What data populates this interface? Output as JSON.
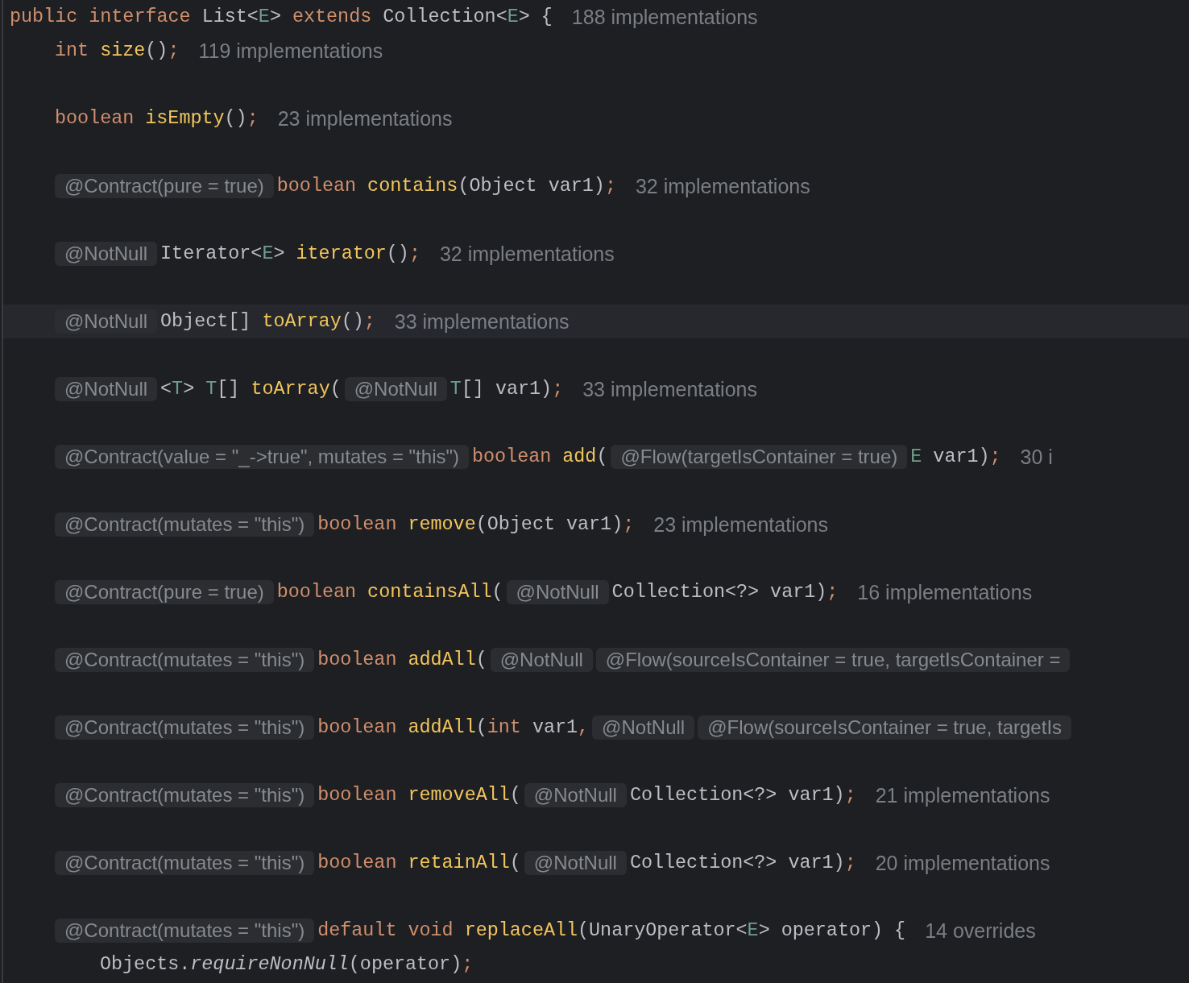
{
  "code": [
    {
      "kind": "code",
      "current": false,
      "tokens": [
        {
          "kind": "kw",
          "text": "public interface "
        },
        {
          "kind": "type",
          "text": "List"
        },
        {
          "kind": "punct",
          "text": "<"
        },
        {
          "kind": "tp",
          "text": "E"
        },
        {
          "kind": "punct",
          "text": "> "
        },
        {
          "kind": "kw",
          "text": "extends "
        },
        {
          "kind": "type",
          "text": "Collection"
        },
        {
          "kind": "punct",
          "text": "<"
        },
        {
          "kind": "tp",
          "text": "E"
        },
        {
          "kind": "punct",
          "text": "> {"
        }
      ],
      "hint": "188 implementations",
      "children": [
        {
          "kind": "code",
          "current": false,
          "tokens": [
            {
              "kind": "kw",
              "text": "int "
            },
            {
              "kind": "fn",
              "text": "size"
            },
            {
              "kind": "punct",
              "text": "()"
            },
            {
              "kind": "semi",
              "text": ";"
            }
          ],
          "hint": "119 implementations"
        },
        {
          "kind": "blank"
        },
        {
          "kind": "code",
          "current": false,
          "tokens": [
            {
              "kind": "kw",
              "text": "boolean "
            },
            {
              "kind": "fn",
              "text": "isEmpty"
            },
            {
              "kind": "punct",
              "text": "()"
            },
            {
              "kind": "semi",
              "text": ";"
            }
          ],
          "hint": "23 implementations"
        },
        {
          "kind": "blank"
        },
        {
          "kind": "code",
          "current": false,
          "tokens": [
            {
              "kind": "inlay",
              "text": "@Contract(pure = true)"
            },
            {
              "kind": "kw",
              "text": "boolean "
            },
            {
              "kind": "fn",
              "text": "contains"
            },
            {
              "kind": "punct",
              "text": "(Object var1)"
            },
            {
              "kind": "semi",
              "text": ";"
            }
          ],
          "hint": "32 implementations"
        },
        {
          "kind": "blank"
        },
        {
          "kind": "code",
          "current": false,
          "tokens": [
            {
              "kind": "inlay",
              "text": "@NotNull"
            },
            {
              "kind": "type",
              "text": "Iterator"
            },
            {
              "kind": "punct",
              "text": "<"
            },
            {
              "kind": "tp",
              "text": "E"
            },
            {
              "kind": "punct",
              "text": "> "
            },
            {
              "kind": "fn",
              "text": "iterator"
            },
            {
              "kind": "punct",
              "text": "()"
            },
            {
              "kind": "semi",
              "text": ";"
            }
          ],
          "hint": "32 implementations"
        },
        {
          "kind": "blank"
        },
        {
          "kind": "code",
          "current": true,
          "tokens": [
            {
              "kind": "inlay",
              "text": "@NotNull"
            },
            {
              "kind": "type",
              "text": "Object[] "
            },
            {
              "kind": "fn",
              "text": "toArray"
            },
            {
              "kind": "punct",
              "text": "()"
            },
            {
              "kind": "semi",
              "text": ";"
            }
          ],
          "hint": "33 implementations"
        },
        {
          "kind": "blank"
        },
        {
          "kind": "code",
          "current": false,
          "tokens": [
            {
              "kind": "inlay",
              "text": "@NotNull"
            },
            {
              "kind": "punct",
              "text": "<"
            },
            {
              "kind": "tp",
              "text": "T"
            },
            {
              "kind": "punct",
              "text": "> "
            },
            {
              "kind": "tp",
              "text": "T"
            },
            {
              "kind": "punct",
              "text": "[] "
            },
            {
              "kind": "fn",
              "text": "toArray"
            },
            {
              "kind": "punct",
              "text": "("
            },
            {
              "kind": "inlay",
              "text": "@NotNull"
            },
            {
              "kind": "tp",
              "text": "T"
            },
            {
              "kind": "punct",
              "text": "[] var1)"
            },
            {
              "kind": "semi",
              "text": ";"
            }
          ],
          "hint": "33 implementations"
        },
        {
          "kind": "blank"
        },
        {
          "kind": "code",
          "current": false,
          "tokens": [
            {
              "kind": "inlay",
              "text": "@Contract(value = \"_->true\", mutates = \"this\")"
            },
            {
              "kind": "kw",
              "text": "boolean "
            },
            {
              "kind": "fn",
              "text": "add"
            },
            {
              "kind": "punct",
              "text": "("
            },
            {
              "kind": "inlay",
              "text": "@Flow(targetIsContainer = true)"
            },
            {
              "kind": "tp",
              "text": "E"
            },
            {
              "kind": "punct",
              "text": " var1)"
            },
            {
              "kind": "semi",
              "text": ";"
            }
          ],
          "hint": "30 i"
        },
        {
          "kind": "blank"
        },
        {
          "kind": "code",
          "current": false,
          "tokens": [
            {
              "kind": "inlay",
              "text": "@Contract(mutates = \"this\")"
            },
            {
              "kind": "kw",
              "text": "boolean "
            },
            {
              "kind": "fn",
              "text": "remove"
            },
            {
              "kind": "punct",
              "text": "(Object var1)"
            },
            {
              "kind": "semi",
              "text": ";"
            }
          ],
          "hint": "23 implementations"
        },
        {
          "kind": "blank"
        },
        {
          "kind": "code",
          "current": false,
          "tokens": [
            {
              "kind": "inlay",
              "text": "@Contract(pure = true)"
            },
            {
              "kind": "kw",
              "text": "boolean "
            },
            {
              "kind": "fn",
              "text": "containsAll"
            },
            {
              "kind": "punct",
              "text": "("
            },
            {
              "kind": "inlay",
              "text": "@NotNull"
            },
            {
              "kind": "type",
              "text": "Collection<?> var1)"
            },
            {
              "kind": "semi",
              "text": ";"
            }
          ],
          "hint": "16 implementations"
        },
        {
          "kind": "blank"
        },
        {
          "kind": "code",
          "current": false,
          "tokens": [
            {
              "kind": "inlay",
              "text": "@Contract(mutates = \"this\")"
            },
            {
              "kind": "kw",
              "text": "boolean "
            },
            {
              "kind": "fn",
              "text": "addAll"
            },
            {
              "kind": "punct",
              "text": "("
            },
            {
              "kind": "inlay",
              "text": "@NotNull"
            },
            {
              "kind": "inlay",
              "text": "@Flow(sourceIsContainer = true, targetIsContainer ="
            }
          ]
        },
        {
          "kind": "blank"
        },
        {
          "kind": "code",
          "current": false,
          "tokens": [
            {
              "kind": "inlay",
              "text": "@Contract(mutates = \"this\")"
            },
            {
              "kind": "kw",
              "text": "boolean "
            },
            {
              "kind": "fn",
              "text": "addAll"
            },
            {
              "kind": "punct",
              "text": "("
            },
            {
              "kind": "kw",
              "text": "int "
            },
            {
              "kind": "type",
              "text": "var1"
            },
            {
              "kind": "semi",
              "text": ","
            },
            {
              "kind": "inlay",
              "text": "@NotNull"
            },
            {
              "kind": "inlay",
              "text": "@Flow(sourceIsContainer = true, targetIs"
            }
          ]
        },
        {
          "kind": "blank"
        },
        {
          "kind": "code",
          "current": false,
          "tokens": [
            {
              "kind": "inlay",
              "text": "@Contract(mutates = \"this\")"
            },
            {
              "kind": "kw",
              "text": "boolean "
            },
            {
              "kind": "fn",
              "text": "removeAll"
            },
            {
              "kind": "punct",
              "text": "("
            },
            {
              "kind": "inlay",
              "text": "@NotNull"
            },
            {
              "kind": "type",
              "text": "Collection<?> var1)"
            },
            {
              "kind": "semi",
              "text": ";"
            }
          ],
          "hint": "21 implementations"
        },
        {
          "kind": "blank"
        },
        {
          "kind": "code",
          "current": false,
          "tokens": [
            {
              "kind": "inlay",
              "text": "@Contract(mutates = \"this\")"
            },
            {
              "kind": "kw",
              "text": "boolean "
            },
            {
              "kind": "fn",
              "text": "retainAll"
            },
            {
              "kind": "punct",
              "text": "("
            },
            {
              "kind": "inlay",
              "text": "@NotNull"
            },
            {
              "kind": "type",
              "text": "Collection<?> var1)"
            },
            {
              "kind": "semi",
              "text": ";"
            }
          ],
          "hint": "20 implementations"
        },
        {
          "kind": "blank"
        },
        {
          "kind": "code",
          "current": false,
          "tokens": [
            {
              "kind": "inlay",
              "text": "@Contract(mutates = \"this\")"
            },
            {
              "kind": "kw",
              "text": "default void "
            },
            {
              "kind": "fn",
              "text": "replaceAll"
            },
            {
              "kind": "punct",
              "text": "(UnaryOperator<"
            },
            {
              "kind": "tp",
              "text": "E"
            },
            {
              "kind": "punct",
              "text": "> operator) {"
            }
          ],
          "hint": "14 overrides",
          "children": [
            {
              "kind": "code",
              "current": false,
              "tokens": [
                {
                  "kind": "type",
                  "text": "Objects."
                },
                {
                  "kind": "static",
                  "text": "requireNonNull"
                },
                {
                  "kind": "punct",
                  "text": "(operator)"
                },
                {
                  "kind": "semi",
                  "text": ";"
                }
              ]
            }
          ]
        }
      ]
    }
  ]
}
